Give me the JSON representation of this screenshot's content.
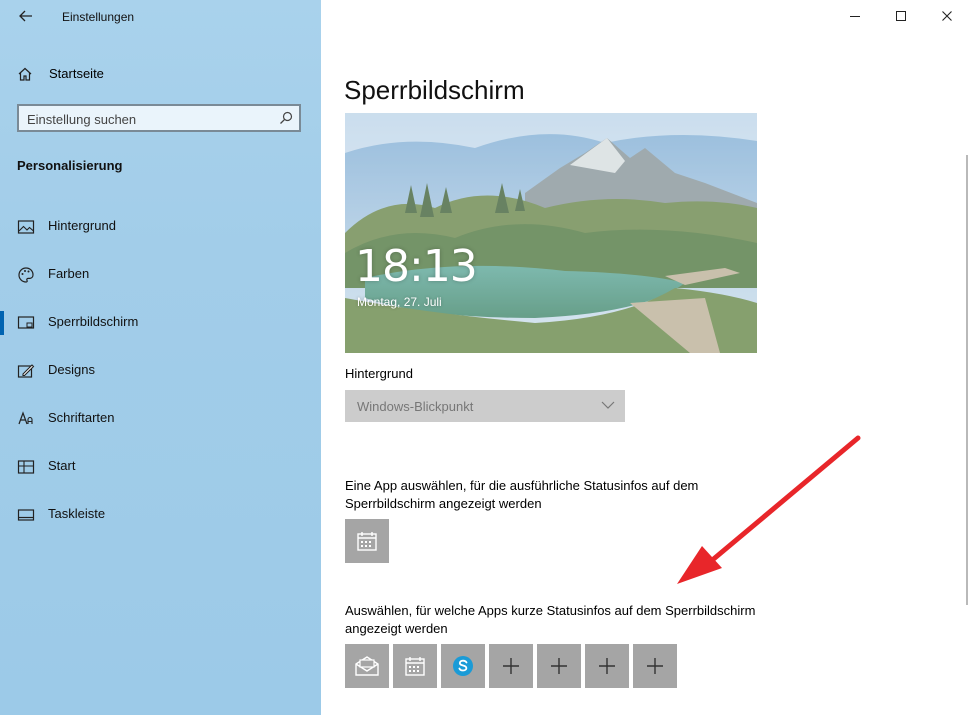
{
  "window": {
    "title": "Einstellungen"
  },
  "sidebar": {
    "home_label": "Startseite",
    "search": {
      "placeholder": "Einstellung suchen"
    },
    "section": "Personalisierung",
    "items": [
      {
        "label": "Hintergrund",
        "icon": "picture-icon"
      },
      {
        "label": "Farben",
        "icon": "palette-icon"
      },
      {
        "label": "Sperrbildschirm",
        "icon": "lock-screen-icon",
        "active": true
      },
      {
        "label": "Designs",
        "icon": "designs-icon"
      },
      {
        "label": "Schriftarten",
        "icon": "fonts-icon"
      },
      {
        "label": "Start",
        "icon": "start-icon"
      },
      {
        "label": "Taskleiste",
        "icon": "taskbar-icon"
      }
    ],
    "accent_color": "#0063b1"
  },
  "main": {
    "title": "Sperrbildschirm",
    "preview": {
      "time": "18:13",
      "date": "Montag, 27. Juli"
    },
    "background_label": "Hintergrund",
    "background_select": {
      "selected": "Windows-Blickpunkt"
    },
    "detail_status_label": "Eine App auswählen, für die ausführliche Statusinfos auf dem Sperrbildschirm angezeigt werden",
    "detail_app": "calendar-icon",
    "quick_status_label": "Auswählen, für welche Apps kurze Statusinfos auf dem Sperrbildschirm angezeigt werden",
    "quick_apps": [
      "mail-icon",
      "calendar-icon",
      "skype-icon",
      "plus-icon",
      "plus-icon",
      "plus-icon",
      "plus-icon"
    ]
  }
}
